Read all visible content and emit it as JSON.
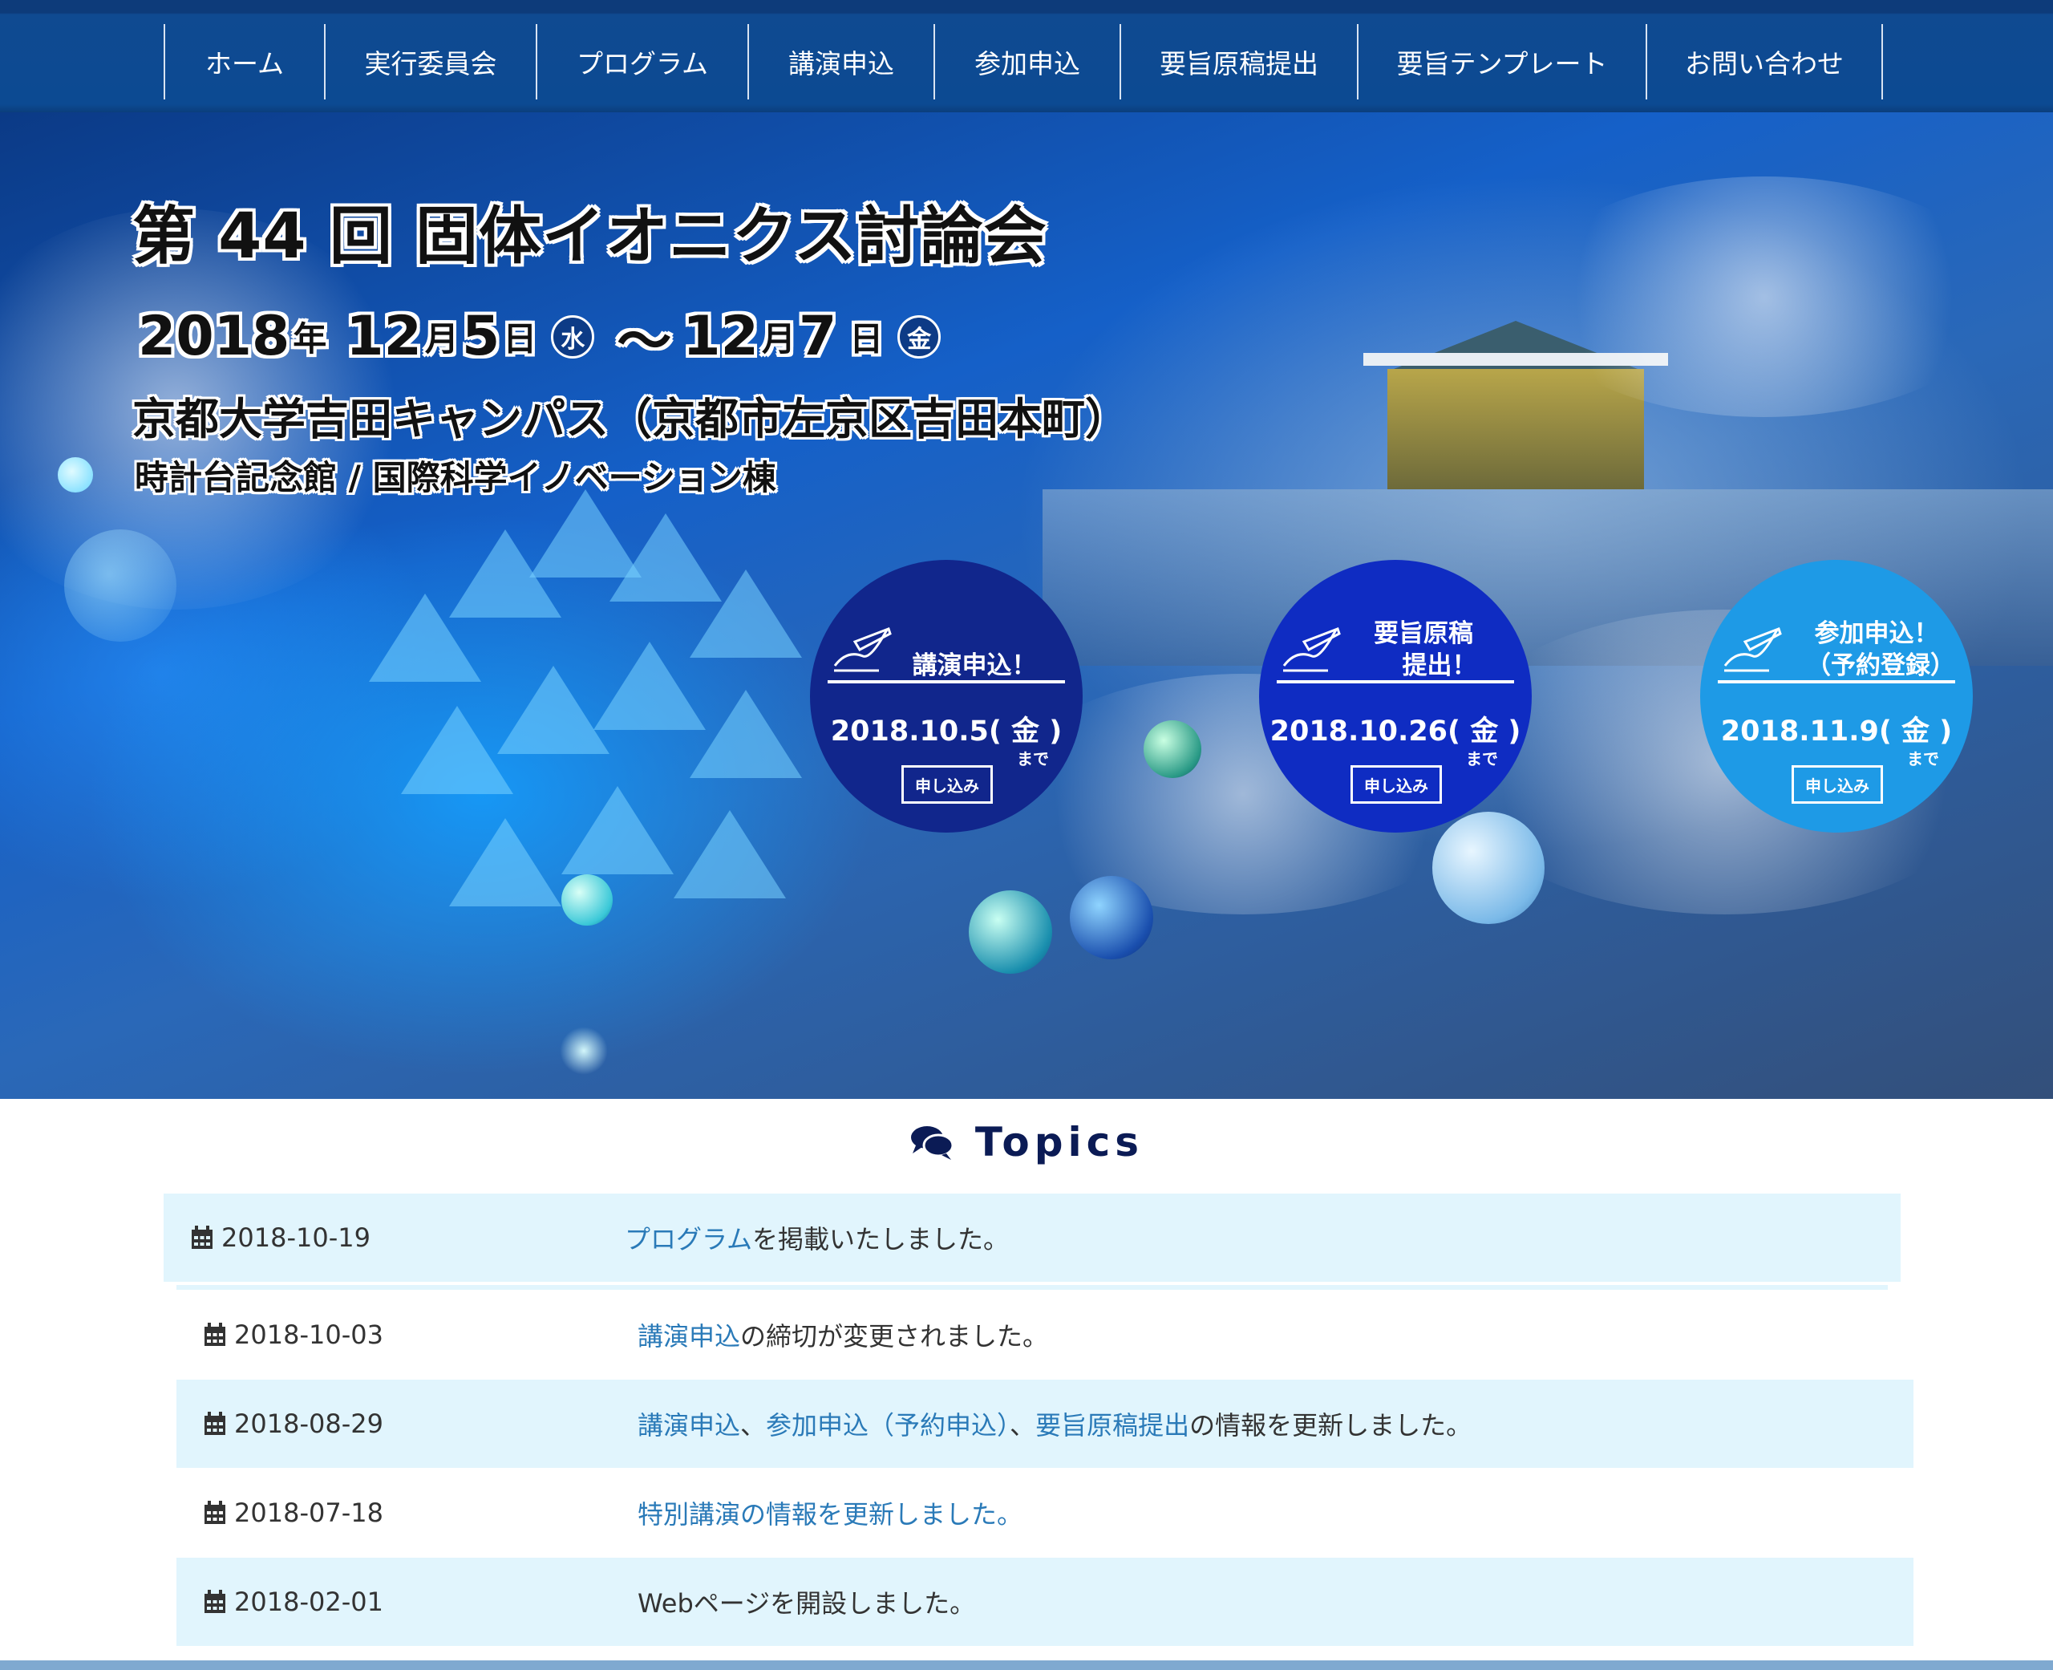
{
  "nav": {
    "items": [
      "ホーム",
      "実行委員会",
      "プログラム",
      "講演申込",
      "参加申込",
      "要旨原稿提出",
      "要旨テンプレート",
      "お問い合わせ"
    ]
  },
  "hero": {
    "title": "第 44 回 固体イオニクス討論会",
    "date": {
      "year": "2018",
      "nen": "年",
      "m1": "12",
      "d1": "5",
      "dow1": "水",
      "tilde": "〜",
      "m2": "12",
      "d2": "7",
      "dow2": "金",
      "tsuki": "月",
      "nichi": "日"
    },
    "venue": "京都大学吉田キャンパス（京都市左京区吉田本町）",
    "sub": "時計台記念館 / 国際科学イノベーション棟"
  },
  "circles": [
    {
      "head1": "講演申込！",
      "head2": "",
      "date": "2018.10.5( 金 )",
      "made": "まで",
      "button": "申し込み",
      "color": "#11268c"
    },
    {
      "head1": "要旨原稿",
      "head2": "提出！",
      "date": "2018.10.26( 金 )",
      "made": "まで",
      "button": "申し込み",
      "color": "#0f2cc2"
    },
    {
      "head1": "参加申込！",
      "head2": "（予約登録）",
      "date": "2018.11.9( 金 )",
      "made": "まで",
      "button": "申し込み",
      "color": "#1e9ae6"
    }
  ],
  "topics": {
    "title": "Topics",
    "rows": [
      {
        "date": "2018-10-19",
        "link1": "プログラム",
        "text1": "を掲載いたしました。"
      },
      {
        "date": "2018-10-03",
        "link1": "講演申込",
        "text1": "の締切が変更されました。"
      },
      {
        "date": "2018-08-29",
        "link1": "講演申込",
        "sep1": "、",
        "link2": "参加申込（予約申込）",
        "sep2": "、",
        "link3": "要旨原稿提出",
        "text1": "の情報を更新しました。"
      },
      {
        "date": "2018-07-18",
        "link1": "特別講演の情報を更新しました。"
      },
      {
        "date": "2018-02-01",
        "text1": "Webページを開設しました。"
      }
    ]
  }
}
